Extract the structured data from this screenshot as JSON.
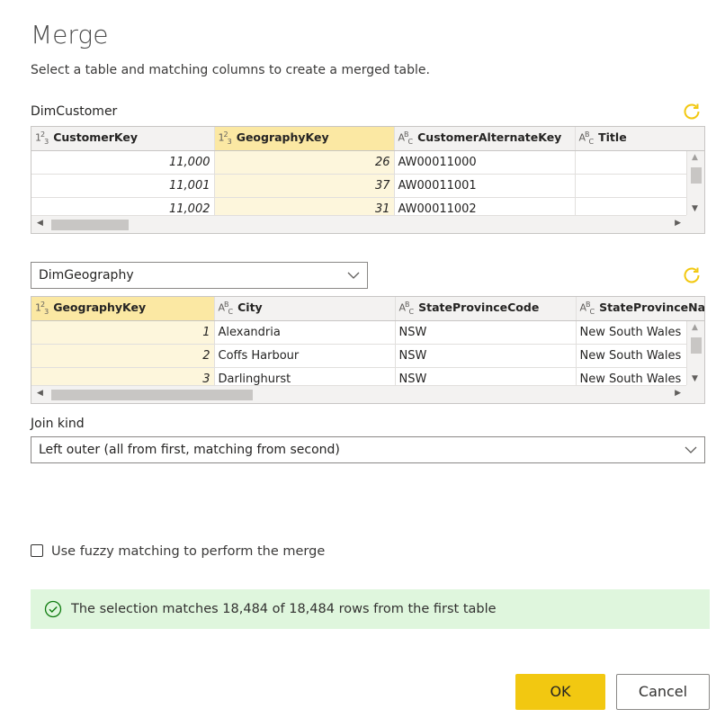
{
  "dialog": {
    "title": "Merge",
    "subtitle": "Select a table and matching columns to create a merged table."
  },
  "table1": {
    "name": "DimCustomer",
    "columns": [
      {
        "type": "123",
        "name": "CustomerKey"
      },
      {
        "type": "ABC",
        "name": "GeographyKey"
      },
      {
        "type": "ABC",
        "name": "CustomerAlternateKey"
      },
      {
        "type": "ABC",
        "name": "Title"
      }
    ],
    "rows": [
      [
        "11,000",
        "26",
        "AW00011000",
        ""
      ],
      [
        "11,001",
        "37",
        "AW00011001",
        ""
      ],
      [
        "11,002",
        "31",
        "AW00011002",
        ""
      ]
    ]
  },
  "table2": {
    "selected": "DimGeography",
    "columns": [
      {
        "type": "123",
        "name": "GeographyKey"
      },
      {
        "type": "ABC",
        "name": "City"
      },
      {
        "type": "ABC",
        "name": "StateProvinceCode"
      },
      {
        "type": "ABC",
        "name": "StateProvinceNam"
      }
    ],
    "rows": [
      [
        "1",
        "Alexandria",
        "NSW",
        "New South Wales"
      ],
      [
        "2",
        "Coffs Harbour",
        "NSW",
        "New South Wales"
      ],
      [
        "3",
        "Darlinghurst",
        "NSW",
        "New South Wales"
      ]
    ]
  },
  "join": {
    "label": "Join kind",
    "value": "Left outer (all from first, matching from second)"
  },
  "fuzzy": {
    "label": "Use fuzzy matching to perform the merge",
    "checked": false
  },
  "status": {
    "message": "The selection matches 18,484 of 18,484 rows from the first table"
  },
  "buttons": {
    "ok": "OK",
    "cancel": "Cancel"
  },
  "colors": {
    "accent": "#f2c811",
    "selected_header": "#fbe8a3",
    "selected_cell": "#fdf6dc",
    "success_bg": "#dff6dd",
    "success_icon": "#107c10"
  }
}
